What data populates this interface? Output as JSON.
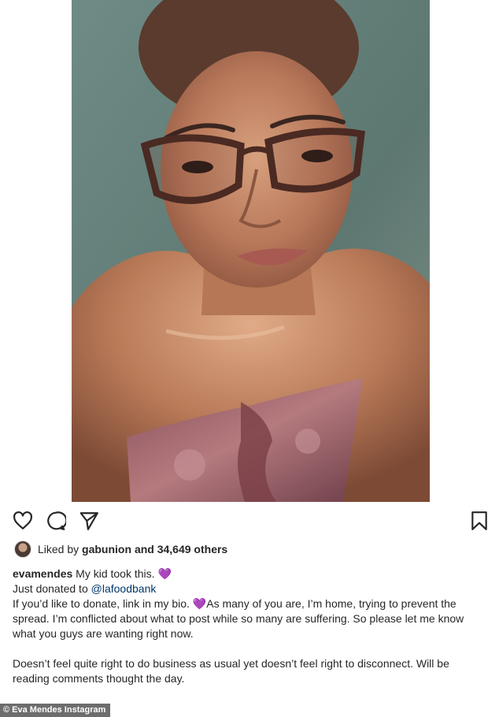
{
  "post": {
    "username": "evamendes",
    "liked_by_prefix": "Liked by",
    "liked_by_user": "gabunion",
    "liked_by_suffix": "and 34,649 others",
    "caption_line1": "My kid took this. ",
    "line2_prefix": "Just donated to ",
    "mention": "@lafoodbank",
    "para1_start": "If you’d like to donate, link in my bio. ",
    "para1_rest": "As many of you are, I’m home, trying to prevent the spread. I’m conflicted about what to post while so many are suffering. So please let me know what you guys are wanting right now.",
    "para2": "Doesn’t feel quite right to do business as usual yet doesn’t feel right to disconnect. Will be reading comments thought the day.",
    "emoji": "💜"
  },
  "icons": {
    "like": "heart-icon",
    "comment": "comment-icon",
    "share": "share-icon",
    "save": "bookmark-icon"
  },
  "credit": "© Eva Mendes Instagram",
  "colors": {
    "link": "#00376b",
    "text": "#262626",
    "credit_bg": "#6d6d6d"
  }
}
